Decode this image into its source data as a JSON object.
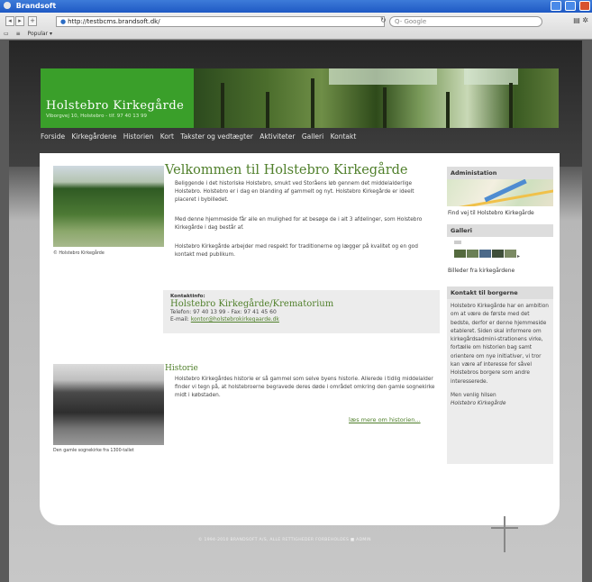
{
  "window": {
    "title": "Brandsoft"
  },
  "browser": {
    "back": "◂",
    "forward": "▸",
    "add": "+",
    "url": "http://testbcms.brandsoft.dk/",
    "reload": "↻",
    "search_placeholder": "Q- Google",
    "page_icon": "▤",
    "gear_icon": "✲",
    "bookmarks": [
      "Popular ▾"
    ]
  },
  "site": {
    "name": "Holstebro Kirkegårde",
    "address": "Viborgvej 10, Holstebro - tlf. 97 40 13 99"
  },
  "nav": [
    "Forside",
    "Kirkegårdene",
    "Historien",
    "Kort",
    "Takster og vedtægter",
    "Aktiviteter",
    "Galleri",
    "Kontakt"
  ],
  "main": {
    "heading": "Velkommen til Holstebro Kirkegårde",
    "intro": "Beliggende i det historiske Holstebro, smukt ved Storåens løb gennem det middelalderlige Holstebro. Holstebro er i dag en blanding af gammelt og nyt. Holstebro Kirkegårde er ideelt placeret i bybilledet.",
    "para2": "Med denne hjemmeside får alle en mulighed for at besøge de i alt 3 afdelinger, som Holstebro Kirkegårde i dag består af.",
    "para3": "Holstebro Kirkegårde arbejder med respekt for traditionerne og lægger på kvalitet og en god kontakt med publikum.",
    "photo_caption": "© Holstebro Kirkegårde",
    "contact_label": "Kontaktinfo:",
    "contact_name": "Holstebro Kirkegårde/Krematorium",
    "contact_phone": "Telefon: 97 40 13 99 - Fax: 97 41 45 60",
    "contact_email_label": "E-mail:",
    "contact_email": "kontor@holstebrokirkegaarde.dk",
    "history_heading": "Historie",
    "history_text": "Holstebro Kirkegårdes historie er så gammel som selve byens historie. Allerede i tidlig middelalder finder vi tegn på, at holstebroerne begravede deres døde i området omkring den gamle sognekirke midt i købstaden.",
    "history_more": "læs mere om historien...",
    "church_caption": "Den gamle sognekirke fra 1300-tallet"
  },
  "sidebar": {
    "admin_heading": "Administation",
    "admin_link": "Find vej til Holstebro Kirkegårde",
    "gallery_heading": "Galleri",
    "gallery_next": "▸",
    "gallery_link": "Billeder fra kirkegårdene",
    "contact_heading": "Kontakt til borgerne",
    "contact_text": "Holstebro Kirkegårde har en ambition om at være de første med det bedste, derfor er denne hjemmeside etableret. Siden skal informere om kirkegårdsadmini-strationens virke, fortælle om historien bag samt orientere om nye initiativer, vi tror kan være af interesse for såvel Holstebros borgere som andre interesserede.",
    "greeting": "Men venlig hilsen",
    "signoff": "Holstebro Kirkegårde"
  },
  "footer": {
    "text": "© 1994-2010 BRANDSOFT A/S, ALLE RETTIGHEDER FORBEHOLDES ■ ADMIN"
  },
  "colors": {
    "brand_green": "#3a9f2a",
    "link_green": "#4f7f2a",
    "titlebar_blue": "#1f59c4"
  }
}
